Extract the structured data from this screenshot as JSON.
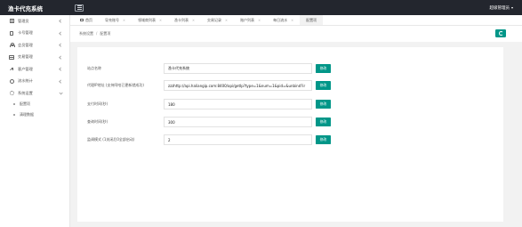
{
  "app": {
    "title": "渔卡代充系统"
  },
  "header": {
    "user_label": "超级管理员"
  },
  "sidebar": {
    "items": [
      {
        "label": "管理员",
        "icon": "grid-icon"
      },
      {
        "label": "卡号管理",
        "icon": "phone-icon"
      },
      {
        "label": "会员管理",
        "icon": "user-icon"
      },
      {
        "label": "交易管理",
        "icon": "card-icon"
      },
      {
        "label": "客户管理",
        "icon": "arrow-icon"
      },
      {
        "label": "流水统计",
        "icon": "circle-icon"
      },
      {
        "label": "系统设置",
        "icon": "gear-icon"
      }
    ],
    "sub_items": [
      {
        "label": "配置项"
      },
      {
        "label": "清理数据"
      }
    ]
  },
  "tabs": [
    {
      "label": "首页",
      "active": false
    },
    {
      "label": "导充账号",
      "active": false
    },
    {
      "label": "领域商列表",
      "active": false
    },
    {
      "label": "渔卡列表",
      "active": false
    },
    {
      "label": "交易记录",
      "active": false
    },
    {
      "label": "账户列表",
      "active": false
    },
    {
      "label": "每日流水",
      "active": false
    },
    {
      "label": "配置项",
      "active": true
    }
  ],
  "breadcrumb": {
    "parent": "系统设置",
    "sep": "/",
    "current": "配置项"
  },
  "config_rows": [
    {
      "label": "站点名称",
      "value": "渔卡代充系统",
      "button": "修改"
    },
    {
      "label": "代理IP地址 (支持阿哈已更新就成功)",
      "value": "zzzhttp://api.haliangip.com:8400/api/getIp?type=1&num=1&pid=&unbind?ir",
      "button": "修改"
    },
    {
      "label": "支付时间(秒)",
      "value": "180",
      "button": "修改"
    },
    {
      "label": "查询时间(秒)",
      "value": "300",
      "button": "修改"
    },
    {
      "label": "监调模式 (1关闭后0全部启动)",
      "value": "2",
      "button": "修改"
    }
  ],
  "colors": {
    "accent": "#009688",
    "topbar": "#23262e"
  }
}
